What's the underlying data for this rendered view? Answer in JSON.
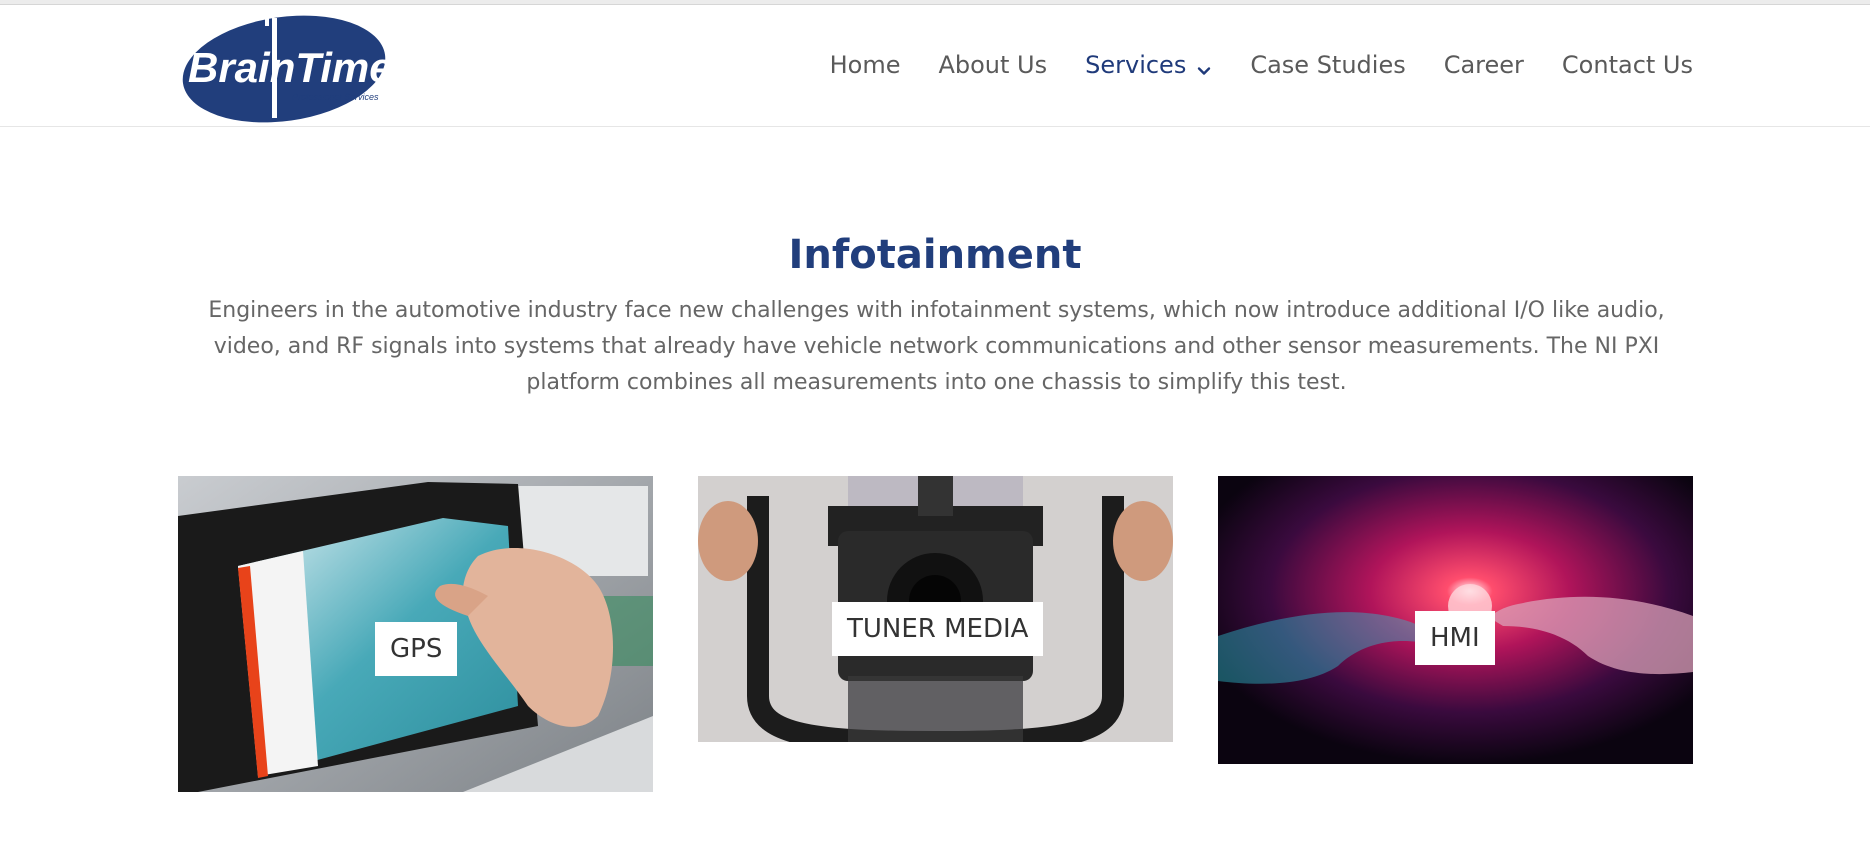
{
  "header": {
    "logo": {
      "text": "BrainTime",
      "tagline": "Professionel Services"
    },
    "nav": [
      {
        "label": "Home",
        "active": false
      },
      {
        "label": "About Us",
        "active": false
      },
      {
        "label": "Services",
        "active": true,
        "has_dropdown": true
      },
      {
        "label": "Case Studies",
        "active": false
      },
      {
        "label": "Career",
        "active": false
      },
      {
        "label": "Contact Us",
        "active": false
      }
    ]
  },
  "main": {
    "title": "Infotainment",
    "description": "Engineers in the automotive industry face new challenges with infotainment systems, which now introduce additional I/O like audio, video, and RF signals into systems that already have vehicle network communications and other sensor measurements. The NI PXI platform combines all measurements into one chassis to simplify this test.",
    "cards": [
      {
        "label": "GPS"
      },
      {
        "label": "TUNER MEDIA"
      },
      {
        "label": "HMI"
      }
    ]
  },
  "colors": {
    "brand": "#213e7c",
    "nav_text": "#5a5a5a",
    "body_text": "#666666"
  }
}
